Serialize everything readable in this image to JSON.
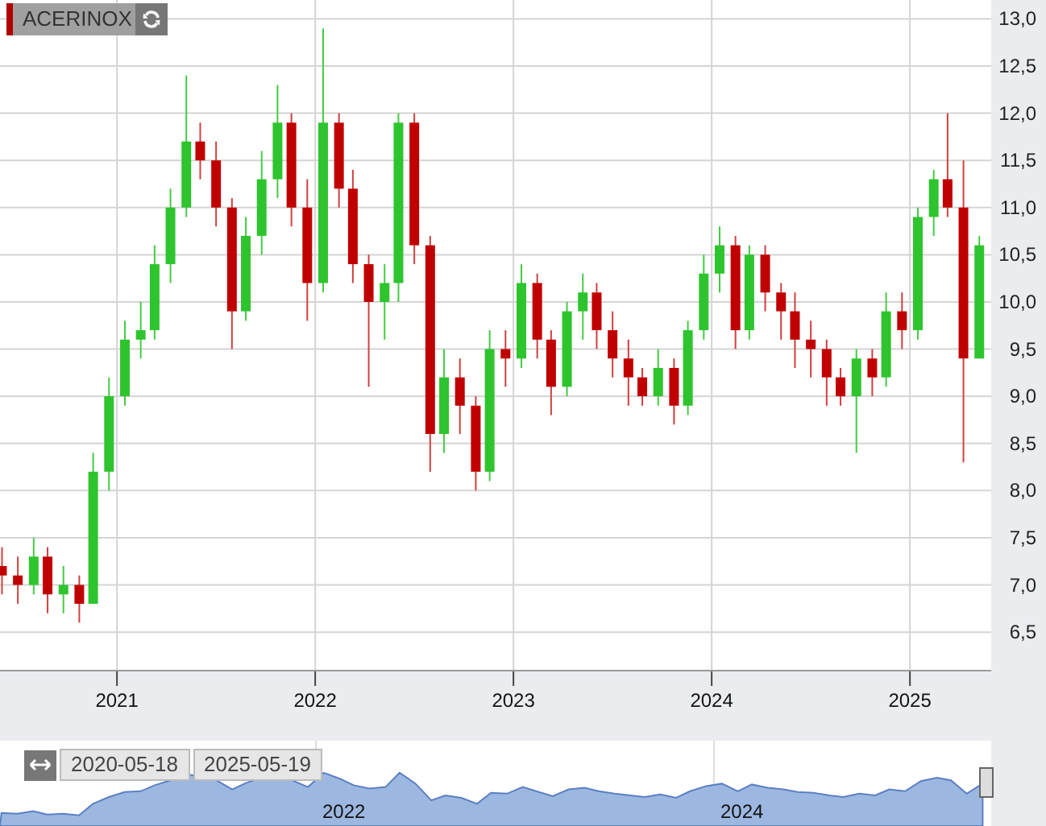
{
  "instrument": {
    "name": "ACERINOX"
  },
  "chart_data": {
    "type": "candlestick",
    "x": [
      2020.42,
      2020.5,
      2020.58,
      2020.65,
      2020.73,
      2020.81,
      2020.88,
      2020.96,
      2021.04,
      2021.12,
      2021.19,
      2021.27,
      2021.35,
      2021.42,
      2021.5,
      2021.58,
      2021.65,
      2021.73,
      2021.81,
      2021.88,
      2021.96,
      2022.04,
      2022.12,
      2022.19,
      2022.27,
      2022.35,
      2022.42,
      2022.5,
      2022.58,
      2022.65,
      2022.73,
      2022.81,
      2022.88,
      2022.96,
      2023.04,
      2023.12,
      2023.19,
      2023.27,
      2023.35,
      2023.42,
      2023.5,
      2023.58,
      2023.65,
      2023.73,
      2023.81,
      2023.88,
      2023.96,
      2024.04,
      2024.12,
      2024.19,
      2024.27,
      2024.35,
      2024.42,
      2024.5,
      2024.58,
      2024.65,
      2024.73,
      2024.81,
      2024.88,
      2024.96,
      2025.04,
      2025.12,
      2025.19,
      2025.27,
      2025.35
    ],
    "ohlc": [
      [
        7.2,
        7.4,
        6.9,
        7.1
      ],
      [
        7.1,
        7.3,
        6.8,
        7.0
      ],
      [
        7.0,
        7.5,
        6.9,
        7.3
      ],
      [
        7.3,
        7.4,
        6.7,
        6.9
      ],
      [
        6.9,
        7.2,
        6.7,
        7.0
      ],
      [
        7.0,
        7.1,
        6.6,
        6.8
      ],
      [
        6.8,
        8.4,
        6.8,
        8.2
      ],
      [
        8.2,
        9.2,
        8.0,
        9.0
      ],
      [
        9.0,
        9.8,
        8.9,
        9.6
      ],
      [
        9.6,
        10.0,
        9.4,
        9.7
      ],
      [
        9.7,
        10.6,
        9.6,
        10.4
      ],
      [
        10.4,
        11.2,
        10.2,
        11.0
      ],
      [
        11.0,
        12.4,
        10.9,
        11.7
      ],
      [
        11.7,
        11.9,
        11.3,
        11.5
      ],
      [
        11.5,
        11.7,
        10.8,
        11.0
      ],
      [
        11.0,
        11.1,
        9.5,
        9.9
      ],
      [
        9.9,
        10.9,
        9.8,
        10.7
      ],
      [
        10.7,
        11.6,
        10.5,
        11.3
      ],
      [
        11.3,
        12.3,
        11.1,
        11.9
      ],
      [
        11.9,
        12.0,
        10.8,
        11.0
      ],
      [
        11.0,
        11.3,
        9.8,
        10.2
      ],
      [
        10.2,
        12.9,
        10.1,
        11.9
      ],
      [
        11.9,
        12.0,
        11.0,
        11.2
      ],
      [
        11.2,
        11.4,
        10.2,
        10.4
      ],
      [
        10.4,
        10.5,
        9.1,
        10.0
      ],
      [
        10.0,
        10.4,
        9.6,
        10.2
      ],
      [
        10.2,
        12.0,
        10.0,
        11.9
      ],
      [
        11.9,
        12.0,
        10.4,
        10.6
      ],
      [
        10.6,
        10.7,
        8.2,
        8.6
      ],
      [
        8.6,
        9.5,
        8.4,
        9.2
      ],
      [
        9.2,
        9.4,
        8.6,
        8.9
      ],
      [
        8.9,
        9.0,
        8.0,
        8.2
      ],
      [
        8.2,
        9.7,
        8.1,
        9.5
      ],
      [
        9.5,
        9.7,
        9.1,
        9.4
      ],
      [
        9.4,
        10.4,
        9.3,
        10.2
      ],
      [
        10.2,
        10.3,
        9.4,
        9.6
      ],
      [
        9.6,
        9.7,
        8.8,
        9.1
      ],
      [
        9.1,
        10.0,
        9.0,
        9.9
      ],
      [
        9.9,
        10.3,
        9.6,
        10.1
      ],
      [
        10.1,
        10.2,
        9.5,
        9.7
      ],
      [
        9.7,
        9.9,
        9.2,
        9.4
      ],
      [
        9.4,
        9.6,
        8.9,
        9.2
      ],
      [
        9.2,
        9.3,
        8.9,
        9.0
      ],
      [
        9.0,
        9.5,
        8.9,
        9.3
      ],
      [
        9.3,
        9.4,
        8.7,
        8.9
      ],
      [
        8.9,
        9.8,
        8.8,
        9.7
      ],
      [
        9.7,
        10.5,
        9.6,
        10.3
      ],
      [
        10.3,
        10.8,
        10.1,
        10.6
      ],
      [
        10.6,
        10.7,
        9.5,
        9.7
      ],
      [
        9.7,
        10.6,
        9.6,
        10.5
      ],
      [
        10.5,
        10.6,
        9.9,
        10.1
      ],
      [
        10.1,
        10.2,
        9.6,
        9.9
      ],
      [
        9.9,
        10.1,
        9.3,
        9.6
      ],
      [
        9.6,
        9.8,
        9.2,
        9.5
      ],
      [
        9.5,
        9.6,
        8.9,
        9.2
      ],
      [
        9.2,
        9.3,
        8.9,
        9.0
      ],
      [
        9.0,
        9.5,
        8.4,
        9.4
      ],
      [
        9.4,
        9.5,
        9.0,
        9.2
      ],
      [
        9.2,
        10.1,
        9.1,
        9.9
      ],
      [
        9.9,
        10.1,
        9.5,
        9.7
      ],
      [
        9.7,
        11.0,
        9.6,
        10.9
      ],
      [
        10.9,
        11.4,
        10.7,
        11.3
      ],
      [
        11.3,
        12.0,
        10.9,
        11.0
      ],
      [
        11.0,
        11.5,
        8.3,
        9.4
      ],
      [
        9.4,
        10.7,
        9.4,
        10.6
      ]
    ],
    "xlim": [
      2020.41,
      2025.41
    ],
    "ylim": [
      6.1,
      13.2
    ],
    "grid": true,
    "xticks": [
      2021,
      2022,
      2023,
      2024,
      2025
    ],
    "yticks": [
      {
        "value": 13,
        "label": "13,0"
      },
      {
        "value": 12.5,
        "label": "12,5"
      },
      {
        "value": 12,
        "label": "12,0"
      },
      {
        "value": 11.5,
        "label": "11,5"
      },
      {
        "value": 11,
        "label": "11,0"
      },
      {
        "value": 10.5,
        "label": "10,5"
      },
      {
        "value": 10,
        "label": "10,0"
      },
      {
        "value": 9.5,
        "label": "9,5"
      },
      {
        "value": 9,
        "label": "9,0"
      },
      {
        "value": 8.5,
        "label": "8,5"
      },
      {
        "value": 8,
        "label": "8,0"
      },
      {
        "value": 7.5,
        "label": "7,5"
      },
      {
        "value": 7,
        "label": "7,0"
      },
      {
        "value": 6.5,
        "label": "6,5"
      }
    ]
  },
  "navigator": {
    "start_date": "2020-05-18",
    "end_date": "2025-05-19",
    "year_labels": [
      "2022",
      "2024"
    ]
  }
}
